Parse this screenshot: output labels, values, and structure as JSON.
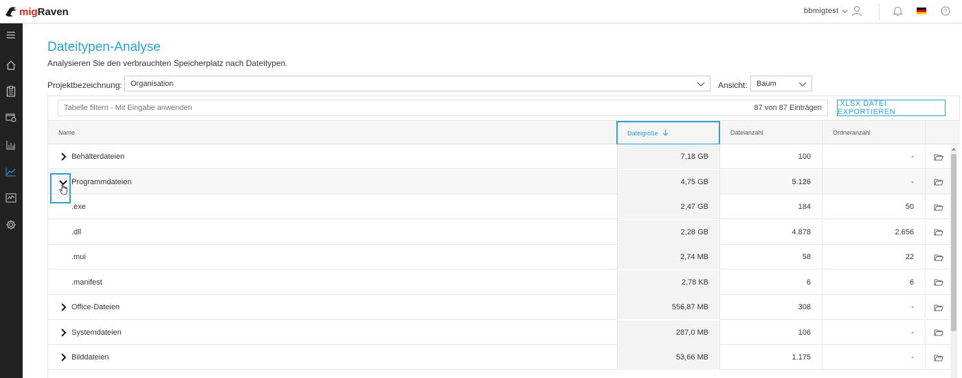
{
  "app": {
    "brand_prefix": "mig",
    "brand_suffix": "Raven"
  },
  "header": {
    "username": "bbmigtest",
    "language_flag": "de-flag-icon"
  },
  "sidebar": {
    "items": [
      "menu-icon",
      "home-icon",
      "clipboard-icon",
      "report-icon",
      "bar-chart-icon",
      "line-chart-icon",
      "activity-chart-icon",
      "settings-icon"
    ],
    "active_index": 5
  },
  "page": {
    "title": "Dateitypen-Analyse",
    "subtitle": "Analysieren Sie den verbrauchten Speicherplatz nach Dateitypen."
  },
  "filters": {
    "project_label": "Projektbezeichnung:",
    "project_value": "Organisation",
    "view_label": "Ansicht:",
    "view_value": "Baum",
    "table_filter_placeholder": "Tabelle filtern - Mit Eingabe anwenden",
    "entries_text": "87 von 87 Einträgen",
    "export_label": ".XLSX DATEI EXPORTIEREN"
  },
  "table": {
    "columns": {
      "name": "Name",
      "size": "Dateigröße",
      "count": "Dateianzahl",
      "folders": "Ordneranzahl"
    },
    "sort_column": "size",
    "rows": [
      {
        "name": "Behälterdateien",
        "size": "7,18 GB",
        "count": "100",
        "folders": "-",
        "level": 0,
        "expander": "collapsed"
      },
      {
        "name": "Programmdateien",
        "size": "4,75 GB",
        "count": "5.126",
        "folders": "-",
        "level": 0,
        "expander": "expanded"
      },
      {
        "name": ".exe",
        "size": "2,47 GB",
        "count": "184",
        "folders": "50",
        "level": 1,
        "expander": "none"
      },
      {
        "name": ".dll",
        "size": "2,28 GB",
        "count": "4.878",
        "folders": "2.656",
        "level": 1,
        "expander": "none"
      },
      {
        "name": ".mui",
        "size": "2,74 MB",
        "count": "58",
        "folders": "22",
        "level": 1,
        "expander": "none"
      },
      {
        "name": ".manifest",
        "size": "2,78 KB",
        "count": "6",
        "folders": "6",
        "level": 1,
        "expander": "none"
      },
      {
        "name": "Office-Dateien",
        "size": "556,87 MB",
        "count": "308",
        "folders": "-",
        "level": 0,
        "expander": "collapsed"
      },
      {
        "name": "Systemdateien",
        "size": "287,0 MB",
        "count": "106",
        "folders": "-",
        "level": 0,
        "expander": "collapsed"
      },
      {
        "name": "Bilddateien",
        "size": "53,66 MB",
        "count": "1.175",
        "folders": "-",
        "level": 0,
        "expander": "collapsed"
      }
    ]
  },
  "colors": {
    "accent": "#2a9fd8",
    "sidebar": "#222222",
    "brand_red": "#d9211c"
  }
}
